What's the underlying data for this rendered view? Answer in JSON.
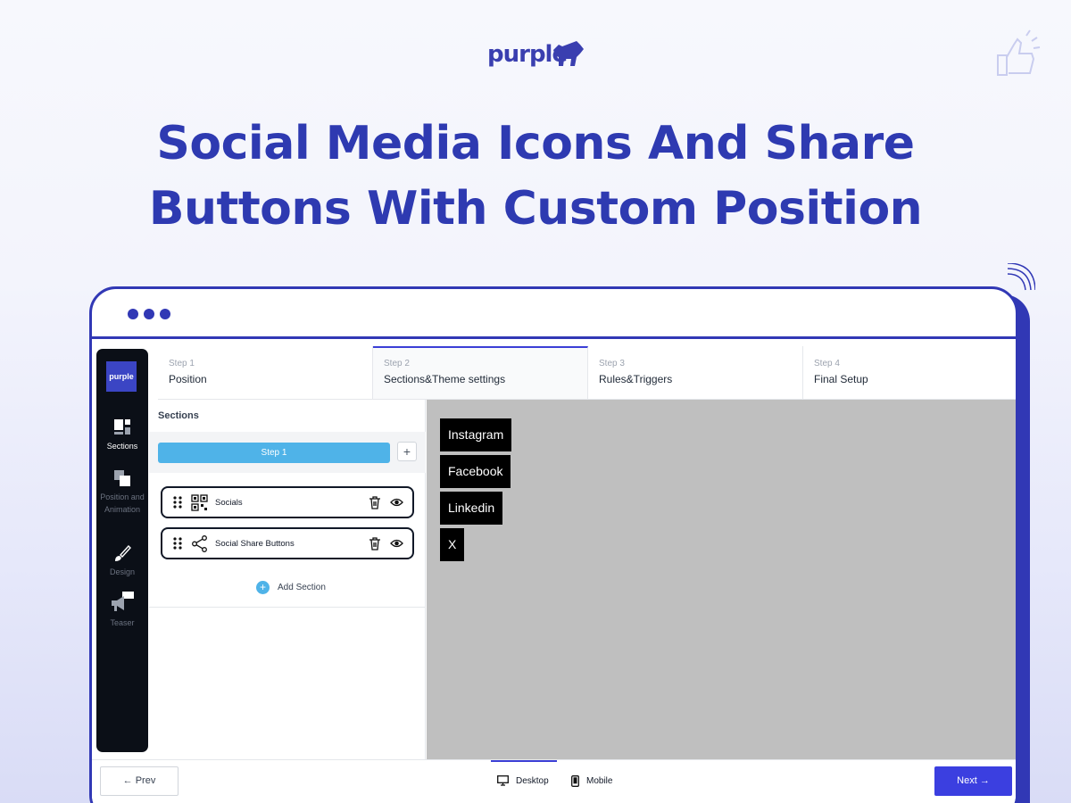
{
  "brand": {
    "name": "purple"
  },
  "headline": {
    "line1": "Social Media Icons And Share",
    "line2": "Buttons With Custom Position"
  },
  "colors": {
    "brand_blue": "#3138b5",
    "accent_blue": "#3b3fe0",
    "step_pill": "#4fb3e8",
    "rail_bg": "#0b0f17",
    "preview_bg": "#bfbfbf"
  },
  "sidebar": {
    "logo_text": "purple",
    "items": [
      {
        "label": "Sections",
        "icon": "sections-icon",
        "active": true
      },
      {
        "label": "Position and Animation",
        "icon": "position-icon",
        "active": false
      },
      {
        "label": "Design",
        "icon": "brush-icon",
        "active": false
      },
      {
        "label": "Teaser",
        "icon": "megaphone-icon",
        "active": false
      }
    ]
  },
  "steps": [
    {
      "num": "Step 1",
      "name": "Position"
    },
    {
      "num": "Step 2",
      "name": "Sections&Theme settings"
    },
    {
      "num": "Step 3",
      "name": "Rules&Triggers"
    },
    {
      "num": "Step 4",
      "name": "Final Setup"
    }
  ],
  "panel": {
    "title": "Sections",
    "step_pill": "Step 1",
    "add_step": "+",
    "sections": [
      {
        "label": "Socials",
        "icon": "qr-code-icon"
      },
      {
        "label": "Social Share Buttons",
        "icon": "share-icon"
      }
    ],
    "add_section": "Add Section"
  },
  "preview": {
    "buttons": [
      "Instagram",
      "Facebook",
      "Linkedin",
      "X"
    ]
  },
  "bottom": {
    "prev": "← Prev",
    "desktop": "Desktop",
    "mobile": "Mobile",
    "next": "Next →"
  }
}
